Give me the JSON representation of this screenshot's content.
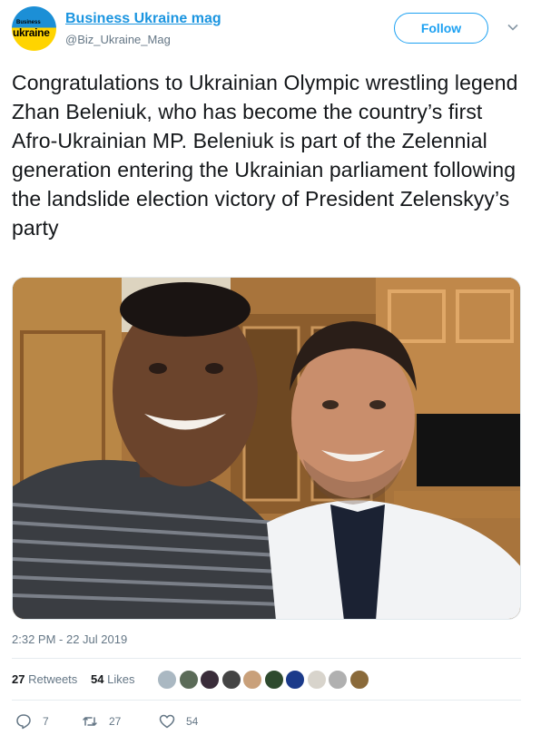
{
  "account": {
    "display_name": "Business Ukraine mag",
    "handle": "@Biz_Ukraine_Mag",
    "avatar_small_text": "Business",
    "avatar_big_text": "ukraine"
  },
  "follow_label": "Follow",
  "tweet_text": "Congratulations to Ukrainian Olympic wrestling legend Zhan Beleniuk, who has become the country’s first Afro-Ukrainian MP. Beleniuk is part of the Zelennial generation entering the Ukrainian parliament following the landslide election victory of President Zelenskyy’s party",
  "timestamp": "2:32 PM - 22 Jul 2019",
  "stats": {
    "retweets_count": "27",
    "retweets_label": "Retweets",
    "likes_count": "54",
    "likes_label": "Likes"
  },
  "liker_avatar_colors": [
    "#aab8c2",
    "#5b6b58",
    "#3a2d3a",
    "#444444",
    "#c9a07a",
    "#2e4a2e",
    "#1b3a8a",
    "#d8d4cc",
    "#b0b0b0",
    "#8a6a3a"
  ],
  "actions": {
    "reply_count": "7",
    "retweet_count": "27",
    "like_count": "54"
  },
  "colors": {
    "link_blue": "#1b95e0",
    "follow_blue": "#1da1f2",
    "muted": "#657786"
  }
}
